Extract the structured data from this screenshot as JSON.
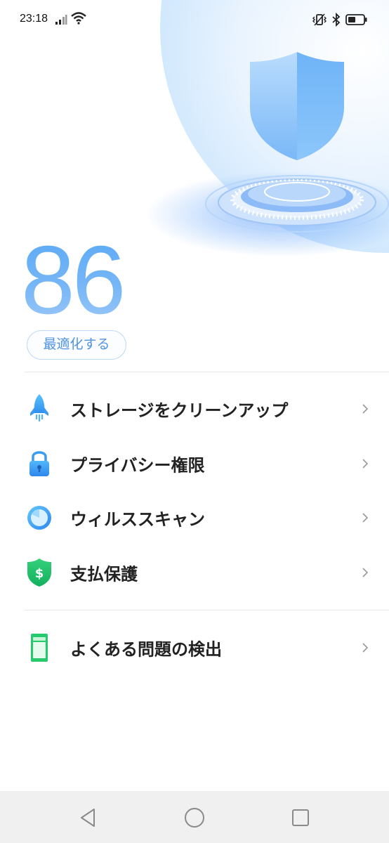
{
  "status_bar": {
    "time": "23:18",
    "icons": [
      "signal-icon",
      "wifi-icon",
      "vibrate-icon",
      "bluetooth-icon",
      "battery-icon"
    ]
  },
  "hero": {
    "score": "86",
    "optimize_label": "最適化する"
  },
  "menu": {
    "items": [
      {
        "label": "ストレージをクリーンアップ",
        "icon": "rocket-icon"
      },
      {
        "label": "プライバシー権限",
        "icon": "lock-icon"
      },
      {
        "label": "ウィルススキャン",
        "icon": "virus-scan-icon"
      },
      {
        "label": "支払保護",
        "icon": "payment-shield-icon"
      }
    ],
    "extra": {
      "label": "よくある問題の検出",
      "icon": "phone-check-icon"
    }
  },
  "colors": {
    "accent": "#4f93e3",
    "score_gradient_top": "#5aa9f6",
    "nav_bar": "#f0f0f0"
  },
  "nav": [
    "back-icon",
    "home-icon",
    "recents-icon"
  ]
}
